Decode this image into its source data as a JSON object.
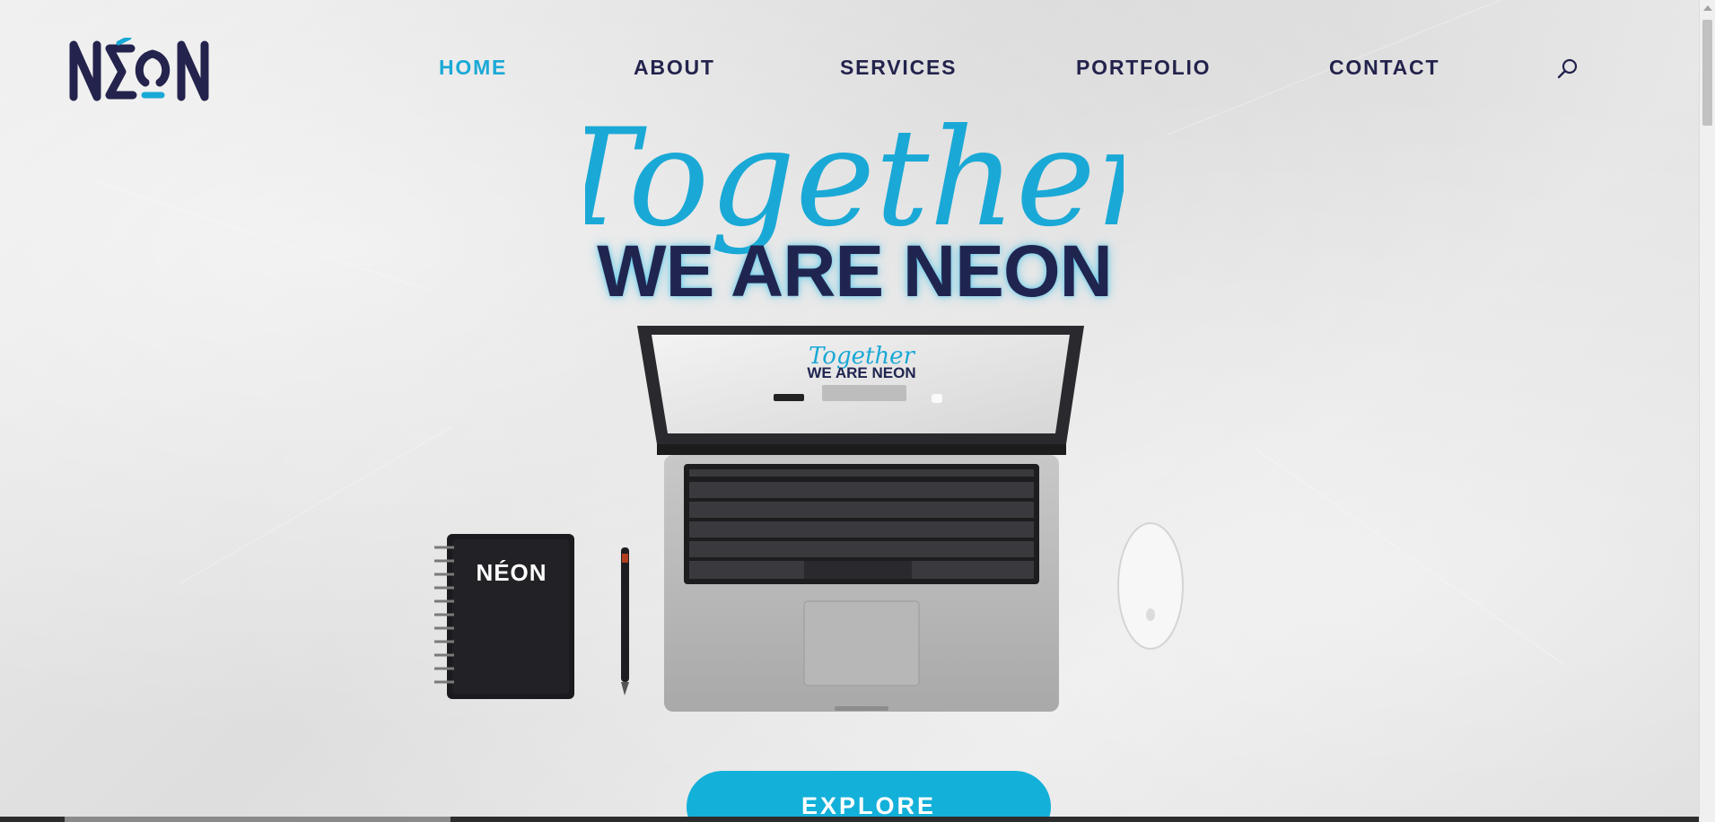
{
  "brand": {
    "logo_text": "NÉON"
  },
  "nav": {
    "items": [
      {
        "label": "HOME",
        "active": true
      },
      {
        "label": "ABOUT",
        "active": false
      },
      {
        "label": "SERVICES",
        "active": false
      },
      {
        "label": "PORTFOLIO",
        "active": false
      },
      {
        "label": "CONTACT",
        "active": false
      }
    ],
    "search_icon": "search-icon"
  },
  "hero": {
    "script_text": "Together",
    "title": "WE ARE NEON",
    "button_label": "EXPLORE"
  },
  "scene": {
    "screen_script": "Together",
    "screen_title": "WE ARE NEON",
    "notebook_logo": "NÉON"
  },
  "colors": {
    "accent": "#1aa9d6",
    "navy": "#23234d",
    "button": "#13b0d9"
  }
}
